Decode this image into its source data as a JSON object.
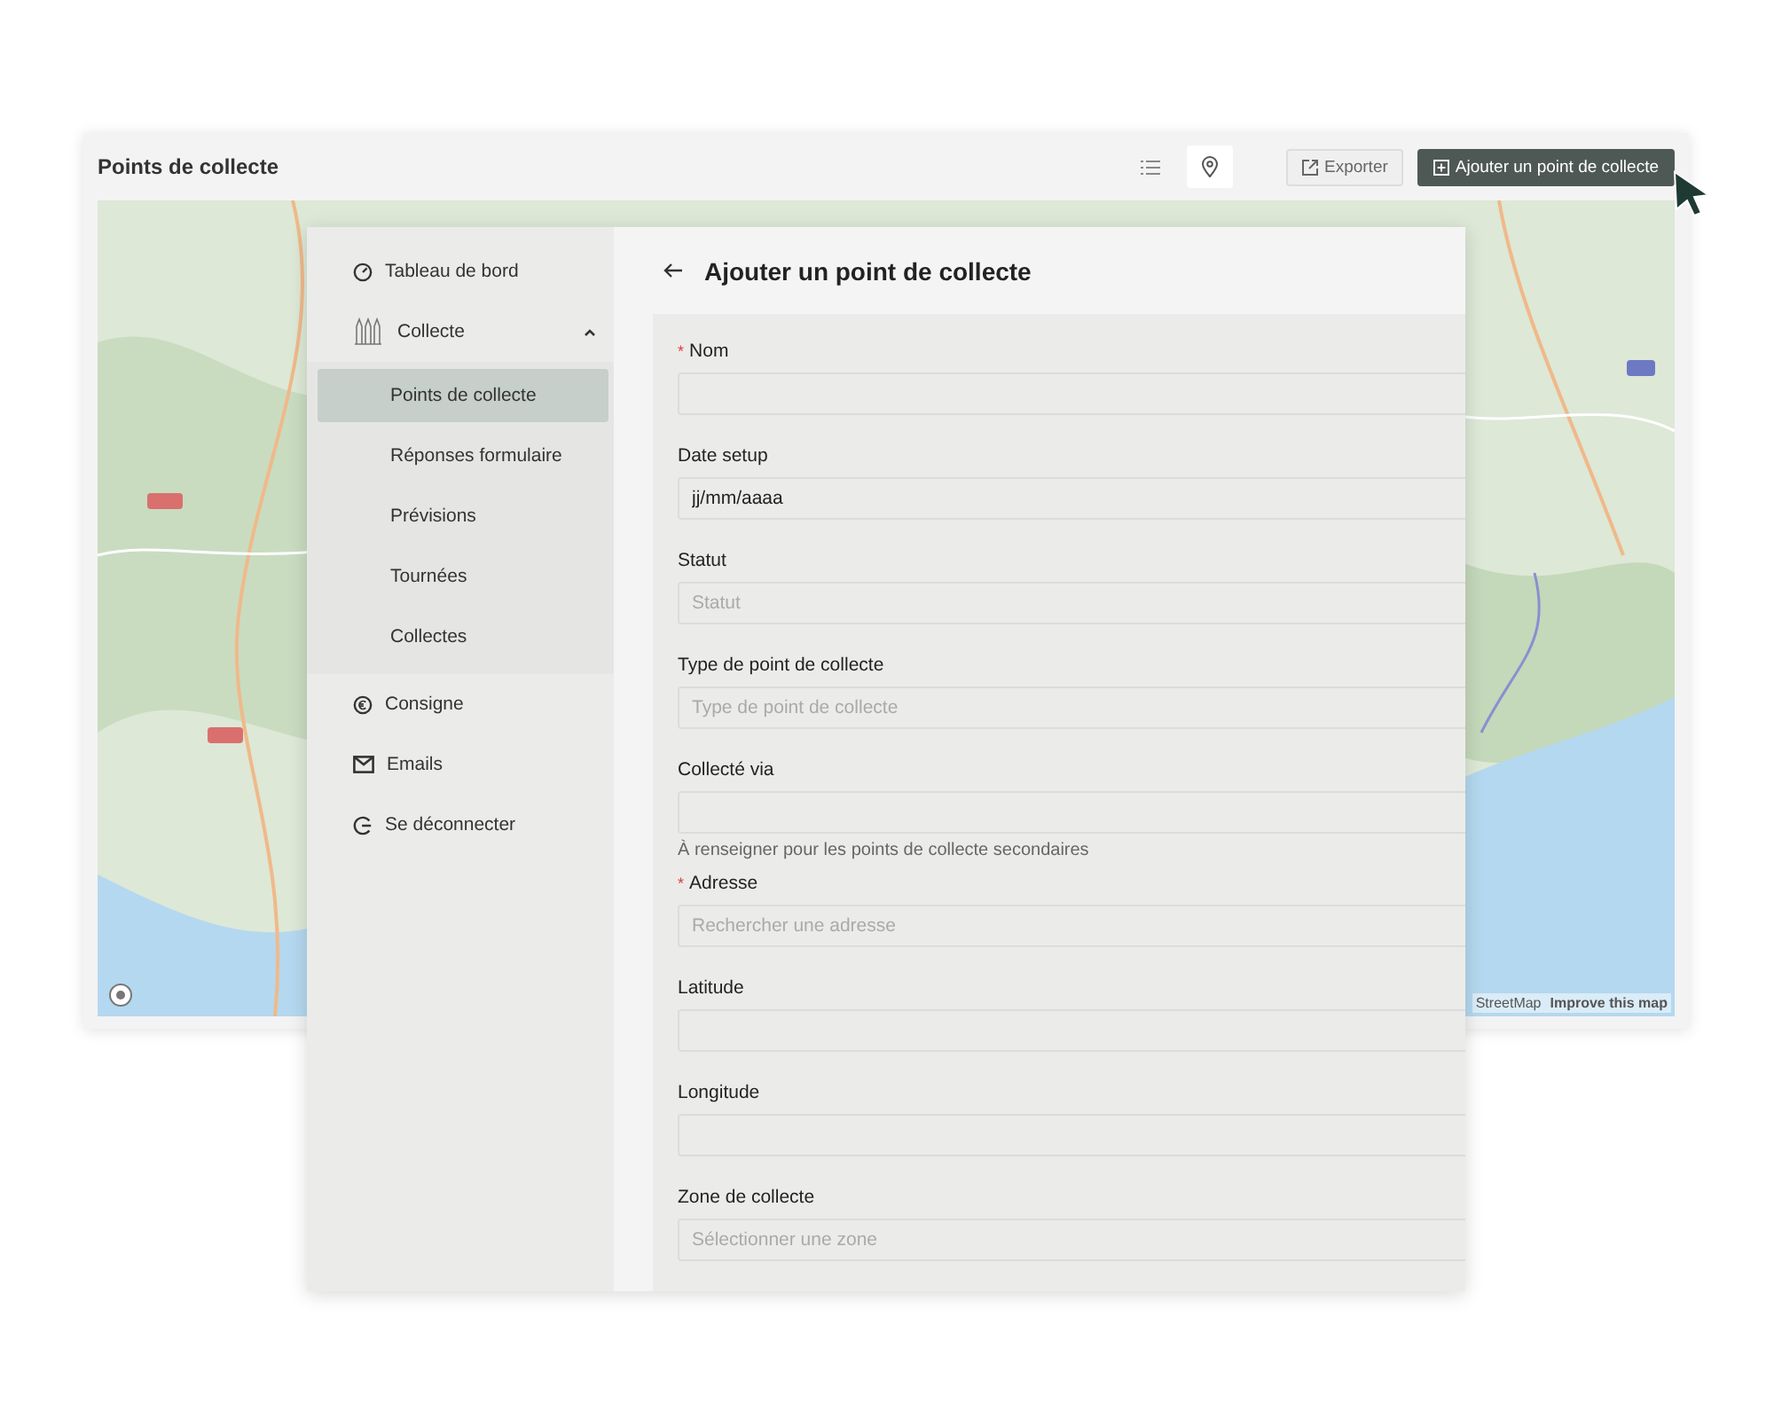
{
  "window": {
    "title": "Points de collecte"
  },
  "view_toggle": [
    {
      "kind": "list",
      "selected": false
    },
    {
      "kind": "map",
      "selected": true
    }
  ],
  "buttons": [
    {
      "kind": "export",
      "label": "Exporter"
    },
    {
      "kind": "add",
      "label": "Ajouter un point de collecte"
    }
  ],
  "map": {
    "attribution": [
      "StreetMap",
      "Improve this map"
    ]
  },
  "sidebar": {
    "items": [
      {
        "kind": "dashboard",
        "label": "Tableau de bord"
      },
      {
        "kind": "collect",
        "label": "Collecte",
        "expanded": true,
        "children": [
          {
            "label": "Points de collecte",
            "selected": true
          },
          {
            "label": "Réponses formulaire",
            "selected": false
          },
          {
            "label": "Prévisions",
            "selected": false
          },
          {
            "label": "Tournées",
            "selected": false
          },
          {
            "label": "Collectes",
            "selected": false
          }
        ]
      },
      {
        "kind": "deposit",
        "label": "Consigne"
      },
      {
        "kind": "mail",
        "label": "Emails"
      },
      {
        "kind": "logout",
        "label": "Se déconnecter"
      }
    ]
  },
  "form": {
    "title": "Ajouter un point de collecte",
    "fields": [
      {
        "label": "Nom",
        "marker": "*"
      },
      {
        "label": "Date setup",
        "value": "jj/mm/aaaa"
      },
      {
        "label": "Statut",
        "placeholder": "Statut"
      },
      {
        "label": "Type de point de collecte",
        "placeholder": "Type de point de collecte"
      },
      {
        "label": "Collecté via",
        "hint": "À renseigner pour les points de collecte secondaires"
      },
      {
        "label": "Adresse",
        "marker": "*",
        "placeholder": "Rechercher une adresse"
      },
      {
        "label": "Latitude"
      },
      {
        "label": "Longitude"
      },
      {
        "label": "Zone de collecte",
        "placeholder": "Sélectionner une zone"
      }
    ]
  }
}
